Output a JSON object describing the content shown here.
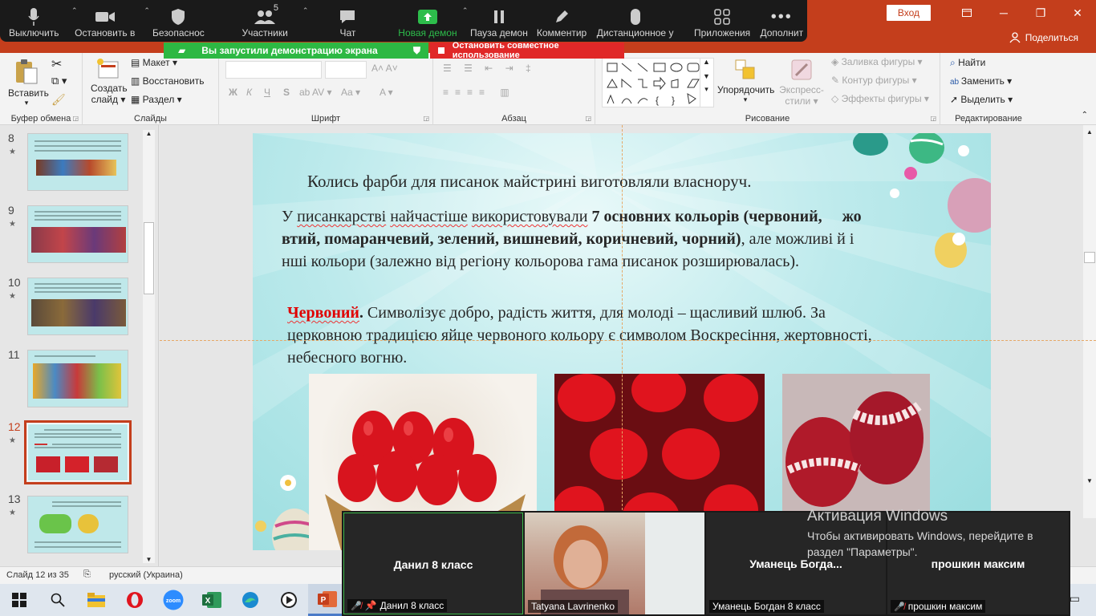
{
  "window": {
    "signin_label": "Вход",
    "share_label": "Поделиться"
  },
  "zoom_toolbar": {
    "items": [
      {
        "label": "Выключить",
        "icon": "microphone-icon"
      },
      {
        "label": "Остановить в",
        "icon": "video-camera-icon"
      },
      {
        "label": "Безопаснос",
        "icon": "shield-icon"
      },
      {
        "label": "Участники",
        "icon": "participants-icon",
        "badge": "5"
      },
      {
        "label": "Чат",
        "icon": "chat-icon"
      },
      {
        "label": "Новая демон",
        "icon": "share-screen-icon"
      },
      {
        "label": "Пауза демон",
        "icon": "pause-icon"
      },
      {
        "label": "Комментир",
        "icon": "pen-icon"
      },
      {
        "label": "Дистанционное у",
        "icon": "mouse-icon"
      },
      {
        "label": "Приложения",
        "icon": "apps-icon"
      },
      {
        "label": "Дополнит",
        "icon": "more-icon"
      }
    ],
    "share_banner": "Вы запустили демонстрацию экрана",
    "stop_banner": "Остановить совместное использование"
  },
  "ribbon": {
    "clipboard": {
      "paste": "Вставить",
      "group": "Буфер обмена"
    },
    "slides": {
      "new_slide_1": "Создать",
      "new_slide_2": "слайд",
      "layout": "Макет",
      "reset": "Восстановить",
      "section": "Раздел",
      "group": "Слайды"
    },
    "font": {
      "group": "Шрифт",
      "bold": "Ж",
      "italic": "К",
      "underline": "Ч",
      "strike": "S",
      "size_label": "Aa"
    },
    "paragraph": {
      "group": "Абзац"
    },
    "drawing": {
      "arrange_1": "Упорядочить",
      "quick_styles_1": "Экспресс-",
      "quick_styles_2": "стили",
      "fill": "Заливка фигуры",
      "outline": "Контур фигуры",
      "effects": "Эффекты фигуры",
      "group": "Рисование"
    },
    "editing": {
      "find": "Найти",
      "replace": "Заменить",
      "select": "Выделить",
      "group": "Редактирование"
    }
  },
  "thumbnails": [
    {
      "num": "8",
      "selected": false
    },
    {
      "num": "9",
      "selected": false
    },
    {
      "num": "10",
      "selected": false
    },
    {
      "num": "11",
      "selected": false
    },
    {
      "num": "12",
      "selected": true
    },
    {
      "num": "13",
      "selected": false
    }
  ],
  "slide": {
    "line1": "Колись фарби для писанок майстрині виготовляли власноруч.",
    "p2_a": "У ",
    "p2_b": "писанкарстві",
    "p2_c": " ",
    "p2_d": "найчастіше",
    "p2_e": " ",
    "p2_f": "використовували",
    "p2_g": " ",
    "p2_bold": "7 основних кольорів (червоний,     жо",
    "p2_line2_bold": "втий, помаранчевий, зелений, вишневий, коричневий, чорний)",
    "p2_line2_rest": ", але можливі й і",
    "p2_line3": "нші кольори (залежно від регіону кольорова гама писанок розширювалась).",
    "red_word": "Червоний",
    "red_dot": ".",
    "red_text_1": " Символізує добро, радість життя, для молоді – щасливий шлюб. За",
    "red_text_2": "церковною традицією яйце червоного кольору є символом Воскресіння, жертовності,",
    "red_text_3": "небесного вогню."
  },
  "video": {
    "tiles": [
      {
        "display_name": "Данил 8 класс",
        "label": "Данил 8 класс",
        "muted": true
      },
      {
        "display_name": "",
        "label": "Tatyana Lavrinenko",
        "muted": false
      },
      {
        "display_name": "Уманець  Богда...",
        "label": "Уманець Богдан 8 класс",
        "muted": false
      },
      {
        "display_name": "прошкин максим",
        "label": "прошкин максим",
        "muted": true
      }
    ]
  },
  "activation": {
    "title": "Активация Windows",
    "line1": "Чтобы активировать Windows, перейдите в",
    "line2": "раздел \"Параметры\"."
  },
  "status": {
    "slide_info": "Слайд 12 из 35",
    "language": "русский (Украина)"
  },
  "taskbar": {
    "apps": [
      "windows-start-icon",
      "search-icon",
      "file-explorer-icon",
      "opera-icon",
      "zoom-icon",
      "excel-icon",
      "edge-icon",
      "media-player-icon",
      "powerpoint-icon"
    ]
  }
}
